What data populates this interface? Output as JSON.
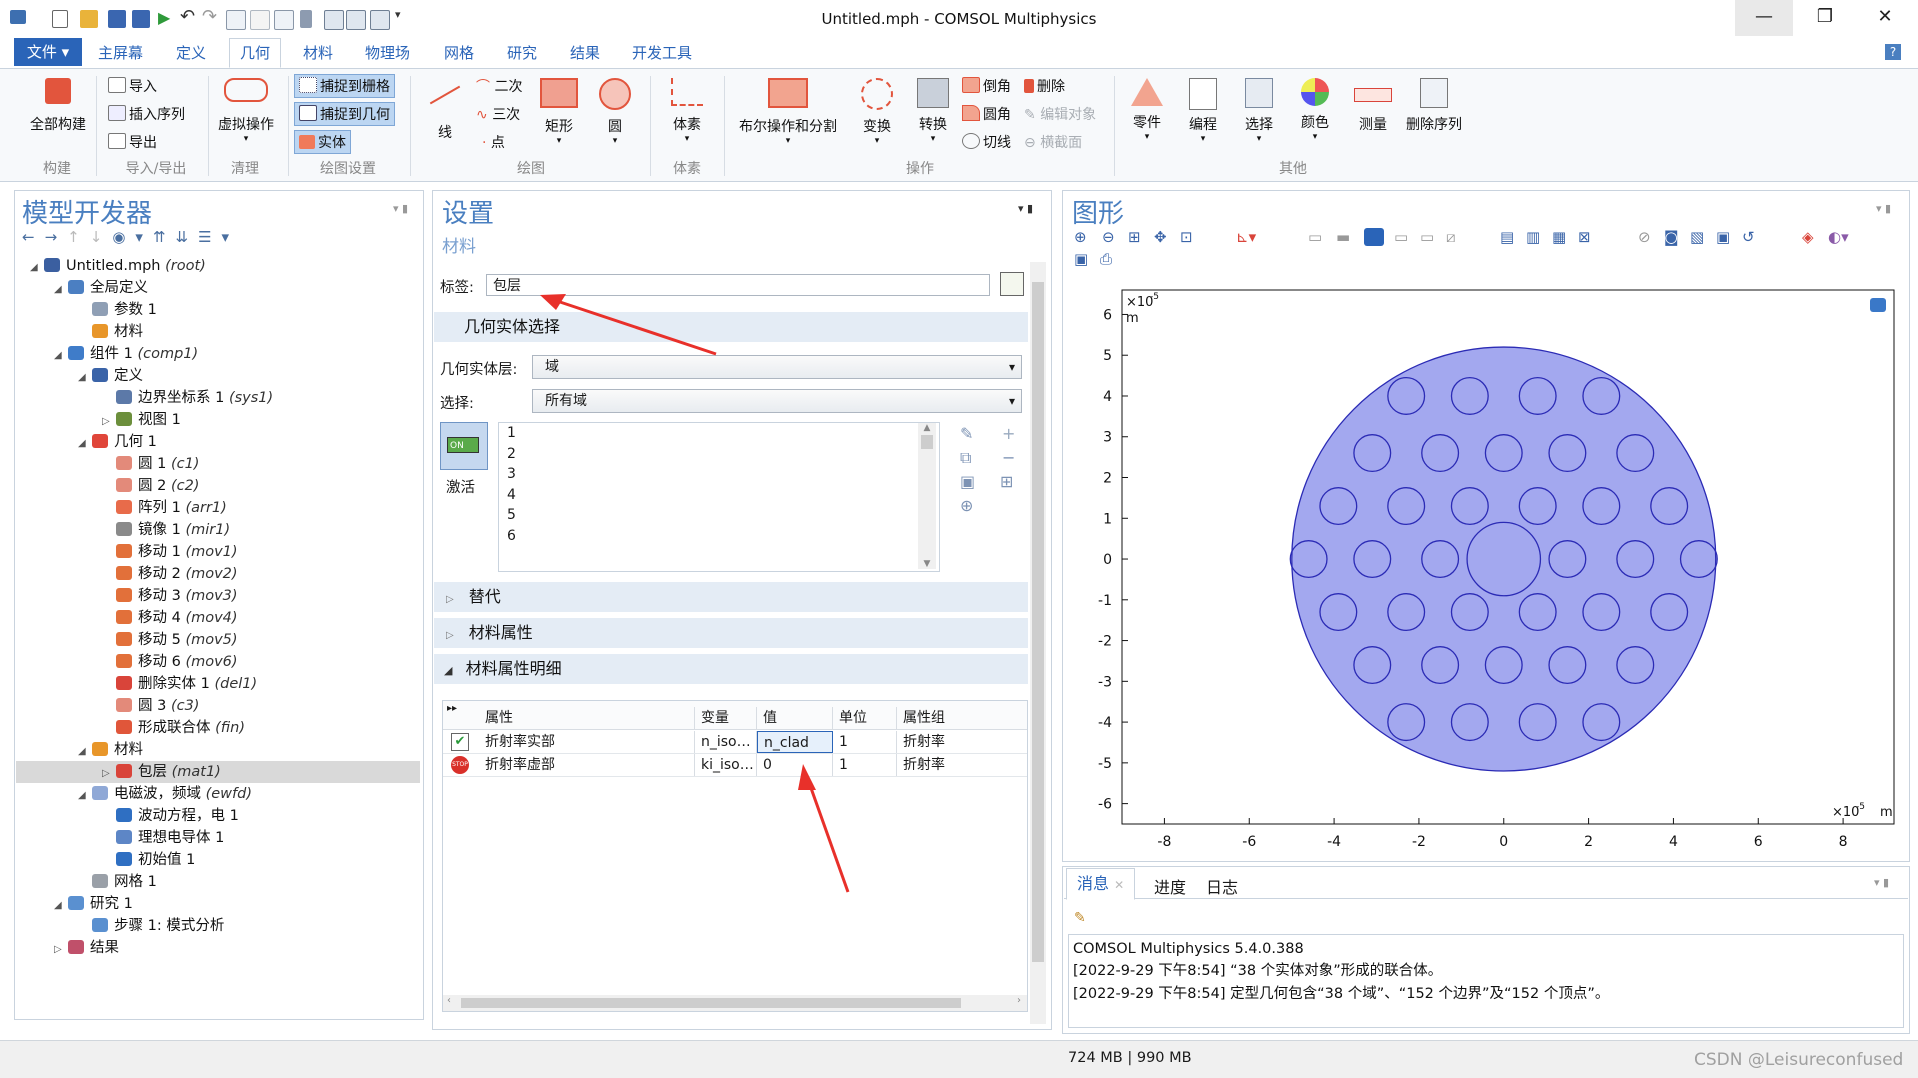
{
  "window": {
    "title": "Untitled.mph - COMSOL Multiphysics",
    "minimize": "—",
    "restore": "❐",
    "close": "✕"
  },
  "menu": {
    "file": "文件 ▾",
    "tabs": [
      "主屏幕",
      "定义",
      "几何",
      "材料",
      "物理场",
      "网格",
      "研究",
      "结果",
      "开发工具"
    ],
    "help": "?"
  },
  "ribbon": {
    "build_all": "全部构建",
    "build_group": "构建",
    "import": "导入",
    "insert_sequence": "插入序列",
    "export": "导出",
    "import_export_group": "导入/导出",
    "virtual_ops": "虚拟操作",
    "cleanup_group": "清理",
    "snap_grid": "捕捉到栅格",
    "snap_geometry": "捕捉到几何",
    "solid": "实体",
    "draw_settings_group": "绘图设置",
    "line": "线",
    "quadratic": "二次",
    "cubic": "三次",
    "point": "点",
    "rectangle": "矩形",
    "circle": "圆",
    "draw_group": "绘图",
    "primitives": "体素",
    "primitives_group": "体素",
    "boolean": "布尔操作和分割",
    "transforms": "变换",
    "conversions": "转换",
    "chamfer": "倒角",
    "fillet": "圆角",
    "tangent": "切线",
    "delete": "删除",
    "edit_object": "编辑对象",
    "cross_section": "横截面",
    "operations_group": "操作",
    "parts": "零件",
    "programming": "编程",
    "selections": "选择",
    "colors": "颜色",
    "measure": "测量",
    "delete_sequence": "删除序列",
    "other_group": "其他"
  },
  "model_builder": {
    "title": "模型开发器",
    "tree": [
      {
        "label": "Untitled.mph",
        "tag": "(root)",
        "indent": 0,
        "arrow": "◢",
        "icon": "#3b5fa0"
      },
      {
        "label": "全局定义",
        "tag": "",
        "indent": 1,
        "arrow": "◢",
        "icon": "#4b7fc2"
      },
      {
        "label": "参数 1",
        "tag": "",
        "indent": 2,
        "arrow": "",
        "icon": "#8f9fb5"
      },
      {
        "label": "材料",
        "tag": "",
        "indent": 2,
        "arrow": "",
        "icon": "#e8962a"
      },
      {
        "label": "组件 1",
        "tag": "(comp1)",
        "indent": 1,
        "arrow": "◢",
        "icon": "#3f7cc9"
      },
      {
        "label": "定义",
        "tag": "",
        "indent": 2,
        "arrow": "◢",
        "icon": "#3a63a8"
      },
      {
        "label": "边界坐标系 1",
        "tag": "(sys1)",
        "indent": 3,
        "arrow": "",
        "icon": "#5c79a8"
      },
      {
        "label": "视图 1",
        "tag": "",
        "indent": 3,
        "arrow": "▷",
        "icon": "#6c8f3c"
      },
      {
        "label": "几何 1",
        "tag": "",
        "indent": 2,
        "arrow": "◢",
        "icon": "#e0463a"
      },
      {
        "label": "圆 1",
        "tag": "(c1)",
        "indent": 3,
        "arrow": "",
        "icon": "#e38a7a"
      },
      {
        "label": "圆 2",
        "tag": "(c2)",
        "indent": 3,
        "arrow": "",
        "icon": "#e38a7a"
      },
      {
        "label": "阵列 1",
        "tag": "(arr1)",
        "indent": 3,
        "arrow": "",
        "icon": "#e86b4a"
      },
      {
        "label": "镜像 1",
        "tag": "(mir1)",
        "indent": 3,
        "arrow": "",
        "icon": "#8a8a8a"
      },
      {
        "label": "移动 1",
        "tag": "(mov1)",
        "indent": 3,
        "arrow": "",
        "icon": "#e2703a"
      },
      {
        "label": "移动 2",
        "tag": "(mov2)",
        "indent": 3,
        "arrow": "",
        "icon": "#e2703a"
      },
      {
        "label": "移动 3",
        "tag": "(mov3)",
        "indent": 3,
        "arrow": "",
        "icon": "#e2703a"
      },
      {
        "label": "移动 4",
        "tag": "(mov4)",
        "indent": 3,
        "arrow": "",
        "icon": "#e2703a"
      },
      {
        "label": "移动 5",
        "tag": "(mov5)",
        "indent": 3,
        "arrow": "",
        "icon": "#e2703a"
      },
      {
        "label": "移动 6",
        "tag": "(mov6)",
        "indent": 3,
        "arrow": "",
        "icon": "#e2703a"
      },
      {
        "label": "删除实体 1",
        "tag": "(del1)",
        "indent": 3,
        "arrow": "",
        "icon": "#d9443a"
      },
      {
        "label": "圆 3",
        "tag": "(c3)",
        "indent": 3,
        "arrow": "",
        "icon": "#e38a7a"
      },
      {
        "label": "形成联合体",
        "tag": "(fin)",
        "indent": 3,
        "arrow": "",
        "icon": "#e0563a"
      },
      {
        "label": "材料",
        "tag": "",
        "indent": 2,
        "arrow": "◢",
        "icon": "#e8962a"
      },
      {
        "label": "包层",
        "tag": "(mat1)",
        "indent": 3,
        "arrow": "▷",
        "icon": "#d9443a",
        "selected": true
      },
      {
        "label": "电磁波，频域",
        "tag": "(ewfd)",
        "indent": 2,
        "arrow": "◢",
        "icon": "#8fa8d6"
      },
      {
        "label": "波动方程，电 1",
        "tag": "",
        "indent": 3,
        "arrow": "",
        "icon": "#2f6fc2"
      },
      {
        "label": "理想电导体 1",
        "tag": "",
        "indent": 3,
        "arrow": "",
        "icon": "#5d86c6"
      },
      {
        "label": "初始值 1",
        "tag": "",
        "indent": 3,
        "arrow": "",
        "icon": "#2f6fc2"
      },
      {
        "label": "网格 1",
        "tag": "",
        "indent": 2,
        "arrow": "",
        "icon": "#9aa0a8"
      },
      {
        "label": "研究 1",
        "tag": "",
        "indent": 1,
        "arrow": "◢",
        "icon": "#5a90d0"
      },
      {
        "label": "步骤 1: 模式分析",
        "tag": "",
        "indent": 2,
        "arrow": "",
        "icon": "#5a90d0"
      },
      {
        "label": "结果",
        "tag": "",
        "indent": 1,
        "arrow": "▷",
        "icon": "#c0506a"
      }
    ]
  },
  "settings": {
    "title": "设置",
    "subtitle": "材料",
    "label_caption": "标签:",
    "label_value": "包层",
    "geom_selection_header": "几何实体选择",
    "geom_level_caption": "几何实体层:",
    "geom_level_value": "域",
    "selection_caption": "选择:",
    "selection_value": "所有域",
    "activate": "激活",
    "on_badge": "ON",
    "domains": [
      "1",
      "2",
      "3",
      "4",
      "5",
      "6"
    ],
    "override_header": "替代",
    "material_props_header": "材料属性",
    "material_contents_header": "材料属性明细",
    "table_headers": [
      "属性",
      "变量",
      "值",
      "单位",
      "属性组"
    ],
    "table_rows": [
      {
        "property": "折射率实部",
        "variable": "n_iso…",
        "value": "n_clad",
        "unit": "1",
        "group": "折射率",
        "status": "ok"
      },
      {
        "property": "折射率虚部",
        "variable": "ki_iso…",
        "value": "0",
        "unit": "1",
        "group": "折射率",
        "status": "stop"
      }
    ]
  },
  "graphics": {
    "title": "图形",
    "y_exp": "×10",
    "y_exp_sup": "-5",
    "y_unit": "m",
    "x_exp": "×10",
    "x_exp_sup": "-5",
    "x_unit": "m",
    "y_ticks": [
      "6",
      "5",
      "4",
      "3",
      "2",
      "1",
      "0",
      "-1",
      "-2",
      "-3",
      "-4",
      "-5",
      "-6"
    ],
    "x_ticks": [
      "-8",
      "-6",
      "-4",
      "-2",
      "0",
      "2",
      "4",
      "6",
      "8"
    ],
    "xlim": [
      -9,
      9.2
    ],
    "ylim": [
      -6.5,
      6.6
    ],
    "cladding_radius": 5.2,
    "hole_radius": 0.45,
    "core_radius": 0.9,
    "fill_color": "#a3a8ef",
    "stroke_color": "#2b2bb5",
    "holes": [
      [
        -2.3,
        4.0
      ],
      [
        -0.8,
        4.0
      ],
      [
        0.8,
        4.0
      ],
      [
        2.3,
        4.0
      ],
      [
        -3.1,
        2.6
      ],
      [
        -1.5,
        2.6
      ],
      [
        0,
        2.6
      ],
      [
        1.5,
        2.6
      ],
      [
        3.1,
        2.6
      ],
      [
        -3.9,
        1.3
      ],
      [
        -2.3,
        1.3
      ],
      [
        -0.8,
        1.3
      ],
      [
        0.8,
        1.3
      ],
      [
        2.3,
        1.3
      ],
      [
        3.9,
        1.3
      ],
      [
        -4.6,
        0
      ],
      [
        -3.1,
        0
      ],
      [
        -1.5,
        0
      ],
      [
        1.5,
        0
      ],
      [
        3.1,
        0
      ],
      [
        4.6,
        0
      ],
      [
        -3.9,
        -1.3
      ],
      [
        -2.3,
        -1.3
      ],
      [
        -0.8,
        -1.3
      ],
      [
        0.8,
        -1.3
      ],
      [
        2.3,
        -1.3
      ],
      [
        3.9,
        -1.3
      ],
      [
        -3.1,
        -2.6
      ],
      [
        -1.5,
        -2.6
      ],
      [
        0,
        -2.6
      ],
      [
        1.5,
        -2.6
      ],
      [
        3.1,
        -2.6
      ],
      [
        -2.3,
        -4.0
      ],
      [
        -0.8,
        -4.0
      ],
      [
        0.8,
        -4.0
      ],
      [
        2.3,
        -4.0
      ]
    ]
  },
  "messages": {
    "tabs": [
      "消息",
      "进度",
      "日志"
    ],
    "lines": [
      "COMSOL Multiphysics 5.4.0.388",
      "[2022-9-29 下午8:54] “38 个实体对象”形成的联合体。",
      "[2022-9-29 下午8:54] 定型几何包含“38 个域”、“152 个边界”及“152 个顶点”。"
    ]
  },
  "status": {
    "memory": "724 MB | 990 MB",
    "watermark": "CSDN @Leisureconfused"
  }
}
